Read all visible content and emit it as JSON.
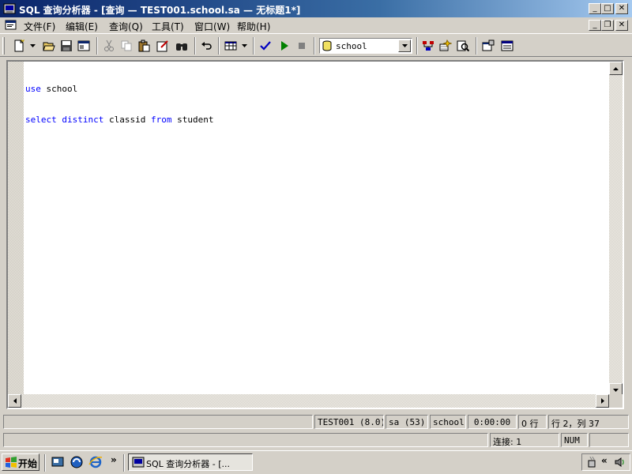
{
  "window": {
    "title": "SQL 查询分析器 - [查询 — TEST001.school.sa — 无标题1*]",
    "min_glyph": "_",
    "max_glyph": "□",
    "close_glyph": "✕"
  },
  "menu": {
    "items": [
      {
        "label": "文件(F)"
      },
      {
        "label": "编辑(E)"
      },
      {
        "label": "查询(Q)"
      },
      {
        "label": "工具(T)"
      },
      {
        "label": "窗口(W)"
      },
      {
        "label": "帮助(H)"
      }
    ]
  },
  "toolbar": {
    "database": "school",
    "icons": [
      "new-query-icon",
      "open-icon",
      "save-icon",
      "insert-template-icon",
      "cut-icon",
      "copy-icon",
      "paste-icon",
      "clear-window-icon",
      "find-icon",
      "undo-icon",
      "results-grid-icon",
      "parse-icon",
      "execute-icon",
      "cancel-icon",
      "database-icon",
      "execution-plan-icon",
      "index-tuning-icon",
      "show-results-icon",
      "object-browser-icon",
      "object-search-icon"
    ]
  },
  "editor": {
    "lines": [
      {
        "kw1": "use",
        "t1": " school",
        "kw2": "",
        "t2": "",
        "kw3": "",
        "t3": ""
      },
      {
        "kw1": "select",
        "t1": " ",
        "kw2": "distinct",
        "t2": " classid ",
        "kw3": "from",
        "t3": " student"
      }
    ],
    "keyword_color": "#0000ff"
  },
  "status": {
    "server": "TEST001 (8.0)",
    "user": "sa (53)",
    "database": "school",
    "elapsed": "0:00:00",
    "rows": "0 行",
    "position": "行 2，列 37",
    "connections": "连接: 1",
    "num": "NUM"
  },
  "taskbar": {
    "start_label": "开始",
    "task_label": "SQL 查询分析器 - [...",
    "chevron": "»",
    "tray_chevron": "«"
  }
}
